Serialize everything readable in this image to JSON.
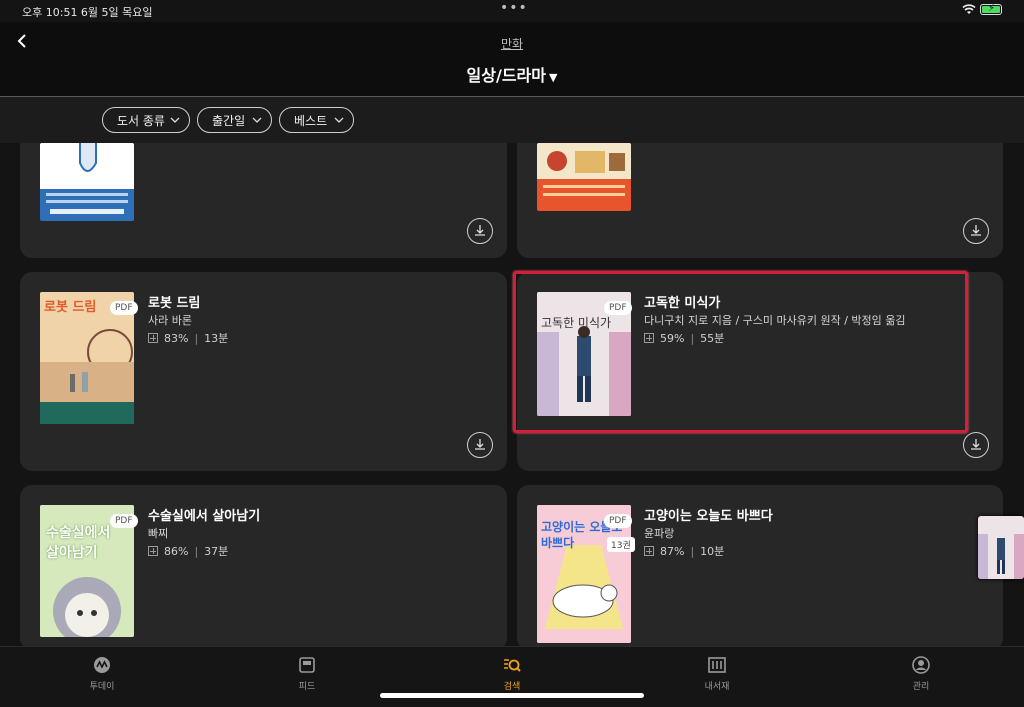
{
  "status_bar": {
    "time": "오후 10:51  6월 5일 목요일"
  },
  "header": {
    "category": "만화",
    "title": "일상/드라마"
  },
  "filters": [
    {
      "label": "도서 종류"
    },
    {
      "label": "출간일"
    },
    {
      "label": "베스트"
    }
  ],
  "books": [
    {
      "title": "로봇 드림",
      "author": "사라 바론",
      "progress": "83%",
      "time": "13분",
      "badge": "PDF",
      "cover_text": "로봇 드림"
    },
    {
      "title": "고독한 미식가",
      "author": "다니구치 지로 지음 / 구스미 마사유키 원작 / 박정임 옮김",
      "progress": "59%",
      "time": "55분",
      "badge": "PDF",
      "cover_text": "고독한 미식가"
    },
    {
      "title": "수술실에서 살아남기",
      "author": "빠찌",
      "progress": "86%",
      "time": "37분",
      "badge": "PDF",
      "cover_text": "수술실에서 살아남기"
    },
    {
      "title": "고양이는 오늘도 바쁘다",
      "author": "윤파랑",
      "progress": "87%",
      "time": "10분",
      "badge": "PDF",
      "volume": "13권",
      "cover_text": "고양이는 오늘도 바쁘다"
    }
  ],
  "tabs": [
    {
      "label": "투데이",
      "icon": "today-icon",
      "active": false
    },
    {
      "label": "피드",
      "icon": "feed-icon",
      "active": false
    },
    {
      "label": "검색",
      "icon": "search-icon",
      "active": true
    },
    {
      "label": "내서재",
      "icon": "library-icon",
      "active": false
    },
    {
      "label": "관리",
      "icon": "profile-icon",
      "active": false
    }
  ],
  "colors": {
    "accent": "#f0a21c",
    "highlight": "#d2203a",
    "card": "#272727"
  }
}
